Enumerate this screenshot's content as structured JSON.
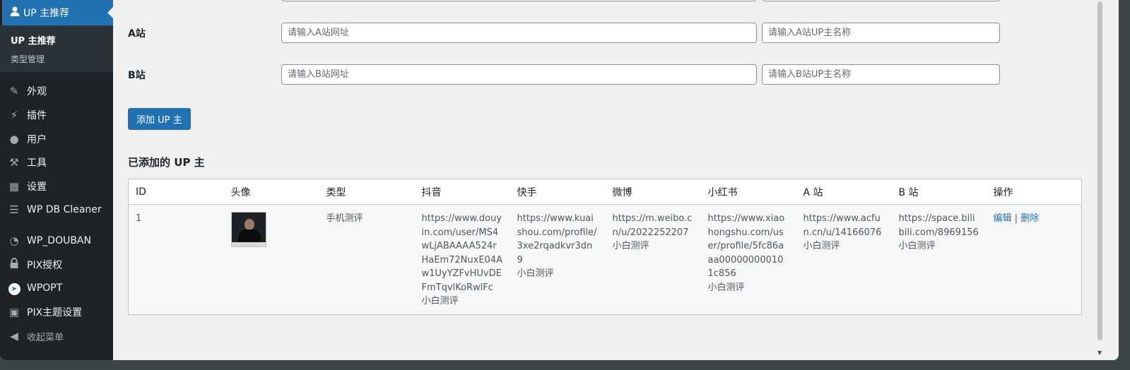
{
  "sidebar": {
    "current": {
      "icon": "user-icon",
      "label": "UP 主推荐"
    },
    "submenu": [
      "UP 主推荐",
      "类型管理"
    ],
    "items": [
      {
        "icon": "brush-icon",
        "glyph": "✎",
        "label": "外观"
      },
      {
        "icon": "plugin-icon",
        "glyph": "⚡",
        "label": "插件"
      },
      {
        "icon": "users-icon",
        "glyph": "●",
        "label": "用户"
      },
      {
        "icon": "wrench-icon",
        "glyph": "⚒",
        "label": "工具"
      },
      {
        "icon": "settings-icon",
        "glyph": "▦",
        "label": "设置"
      },
      {
        "icon": "database-icon",
        "glyph": "☰",
        "label": "WP DB Cleaner"
      },
      {
        "icon": "pie-chart-icon",
        "glyph": "◔",
        "label": "WP_DOUBAN"
      },
      {
        "icon": "lock-icon",
        "glyph": "🔒",
        "label": "PIX授权"
      },
      {
        "icon": "rocket-icon",
        "glyph": "➤",
        "label": "WPOPT"
      },
      {
        "icon": "socket-icon",
        "glyph": "▣",
        "label": "PIX主题设置"
      }
    ],
    "collapse": {
      "icon": "collapse-icon",
      "glyph": "◀",
      "label": "收起菜单"
    }
  },
  "form": {
    "a_station": {
      "label": "A站",
      "url_placeholder": "请输入A站网址",
      "name_placeholder": "请输入A站UP主名称"
    },
    "b_station": {
      "label": "B站",
      "url_placeholder": "请输入B站网址",
      "name_placeholder": "请输入B站UP主名称"
    },
    "submit_label": "添加 UP 主"
  },
  "list": {
    "title": "已添加的 UP 主",
    "columns": [
      "ID",
      "头像",
      "类型",
      "抖音",
      "快手",
      "微博",
      "小红书",
      "A 站",
      "B 站",
      "操作"
    ],
    "rows": [
      {
        "id": "1",
        "type": "手机测评",
        "douyin_url": "https://www.douyin.com/user/MS4wLjABAAAA524rHaEm72NuxE04Aw1UyYZFvHUvDEFmTqvlKoRwlFc",
        "douyin_name": "小白测评",
        "kuaishou_url": "https://www.kuaishou.com/profile/3xe2rqadkvr3dn9",
        "kuaishou_name": "小白测评",
        "weibo_url": "https://m.weibo.cn/u/2022252207",
        "weibo_name": "小白测评",
        "xhs_url": "https://www.xiaohongshu.com/user/profile/5fc86aaa000000000101c856",
        "xhs_name": "小白测评",
        "a_url": "https://www.acfun.cn/u/14166076",
        "a_name": "小白测评",
        "b_url": "https://space.bilibili.com/8969156",
        "b_name": "小白测评",
        "edit_label": "编辑",
        "separator": "|",
        "delete_label": "删除"
      }
    ]
  },
  "colors": {
    "accent": "#2271b1",
    "sidebar_bg": "#1d2327",
    "page_bg": "#f0f0f1"
  }
}
